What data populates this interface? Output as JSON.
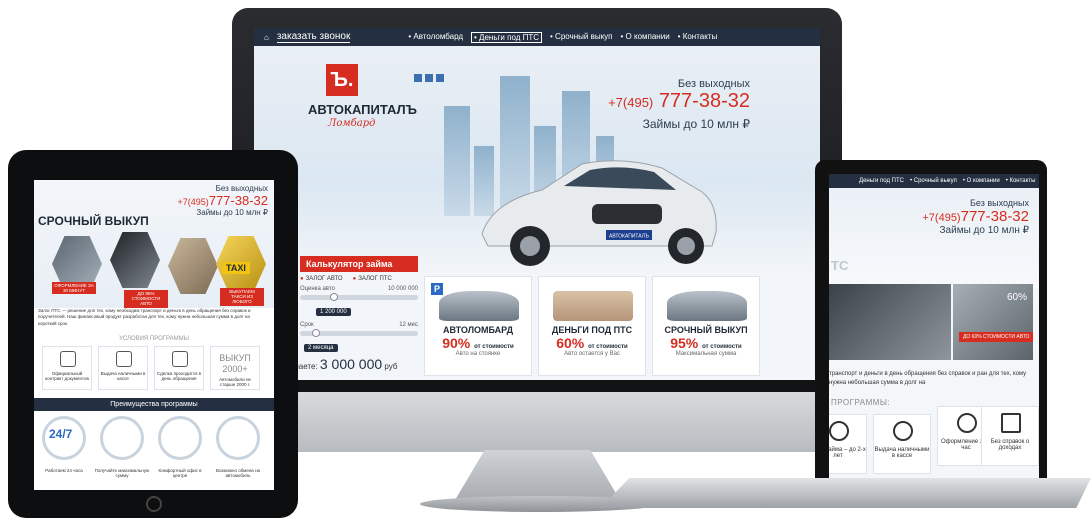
{
  "desktop": {
    "topbar": {
      "call_label": "заказать звонок",
      "nav": [
        "• Автоломбард",
        "• Деньги под ПТС",
        "• Срочный выкуп",
        "• О компании",
        "• Контакты"
      ]
    },
    "logo": {
      "mark": "Ъ.",
      "name": "АВТОКАПИТАЛЪ",
      "sub": "Ломбард"
    },
    "phone": {
      "label": "Без выходных",
      "prefix": "+7(495)",
      "number": "777-38-32",
      "loan": "Займы до 10 млн ₽"
    },
    "car_plate": "АВТОКАПИТАЛЪ",
    "calculator": {
      "title": "Калькулятор займа",
      "options": [
        "ЗАЛОГ АВТО",
        "ЗАЛОГ ПТС"
      ],
      "value_label": "Оценка авто",
      "value_max": "10 000 000",
      "value_current": "1 200 000",
      "term_label": "Срок",
      "term_max": "12 мес",
      "term_current": "2 месяца",
      "result_label": "Вы получаете:",
      "result_value": "3 000 000",
      "result_unit": "руб"
    },
    "cards": [
      {
        "title": "АВТОЛОМБАРД",
        "pct": "90%",
        "pct_note": "от стоимости",
        "sub": "Авто на стоянке"
      },
      {
        "title": "ДЕНЬГИ ПОД ПТС",
        "pct": "60%",
        "pct_note": "от стоимости",
        "sub": "Авто остается у Вас"
      },
      {
        "title": "СРОЧНЫЙ ВЫКУП",
        "pct": "95%",
        "pct_note": "от стоимости",
        "sub": "Максимальная сумма"
      }
    ]
  },
  "laptop": {
    "nav": [
      "Деньги под ПТС",
      "• Срочный выкуп",
      "• О компании",
      "• Контакты"
    ],
    "phone": {
      "label": "Без выходных",
      "prefix": "+7(495)",
      "number": "777-38-32",
      "loan": "Займы до 10 млн ₽"
    },
    "heading_fragment": "ТС",
    "badge_pct": "60%",
    "badge_text": "ДО 60% СТОИМОСТИ АВТО",
    "desc": "транспорт и деньги в день обращения без справок и ран для тех, кому нужна небольшая сумма в долг на",
    "section": "ПРОГРАММЫ:",
    "boxes": [
      "Срок займа – до 2-х лет",
      "Выдача наличными в кассе",
      "Оформление за 1 час",
      "Без справок о доходах"
    ]
  },
  "tablet": {
    "phone": {
      "label": "Без выходных",
      "prefix": "+7(495)",
      "number": "777-38-32",
      "loan": "Займы до 10 млн ₽"
    },
    "title": "СРОЧНЫЙ ВЫКУП",
    "tags": [
      "ОФОРМЛЕНИЕ ЗА 30 МИНУТ",
      "ДО 95% СТОИМОСТИ АВТО",
      "ВЫКУПАЕМ ТАКСИ ИЗ ЛЮБОГО"
    ],
    "taxi": "TAXI",
    "desc": "Залог ПТС — решение для тех, кому необходим транспорт и деньги в день обращения без справок и поручителей. Наш финансовый продукт разработан для тех, кому нужна небольшая сумма в долг на короткий срок.",
    "conditions_title": "УСЛОВИЯ ПРОГРАММЫ",
    "conditions": [
      "Официальный контракт документов",
      "Выдача наличными в кассе",
      "Сделка проходится в день обращения"
    ],
    "year_title": "ВЫКУП 2000+",
    "year_sub": "Автомобили не старше 2000 г.",
    "adv_title": "Преимущества программы",
    "adv_24": "24/7",
    "footer": [
      "Работаем 24 часа",
      "Получайте максимальную сумму",
      "Комфортный офис в центре",
      "Возможно обмена на автомобиль"
    ]
  },
  "colors": {
    "brand_red": "#d62d20",
    "navy": "#243041"
  }
}
